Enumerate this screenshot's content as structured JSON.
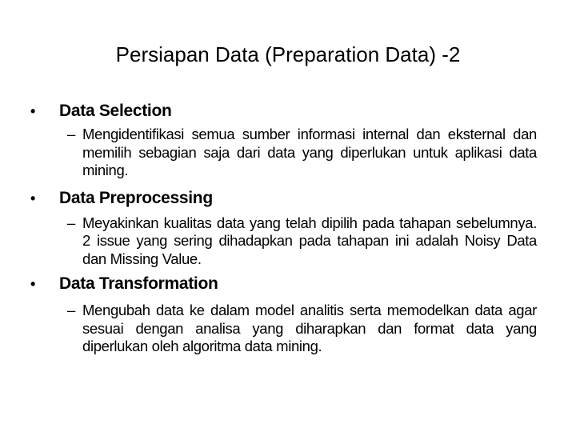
{
  "slide": {
    "title": "Persiapan Data (Preparation Data) -2",
    "bullet_glyph": "•",
    "dash_glyph": "–",
    "sections": [
      {
        "heading": "Data Selection",
        "description": "Mengidentifikasi semua sumber informasi internal dan eksternal dan memilih sebagian saja dari data yang diperlukan untuk aplikasi data mining."
      },
      {
        "heading": "Data Preprocessing",
        "description": "Meyakinkan kualitas data yang telah dipilih pada tahapan sebelumnya. 2 issue yang sering dihadapkan pada tahapan ini adalah Noisy Data dan Missing Value."
      },
      {
        "heading": "Data Transformation",
        "description": "Mengubah data ke dalam model analitis serta memodelkan data agar sesuai dengan analisa yang diharapkan dan format data yang diperlukan oleh algoritma data mining."
      }
    ]
  }
}
